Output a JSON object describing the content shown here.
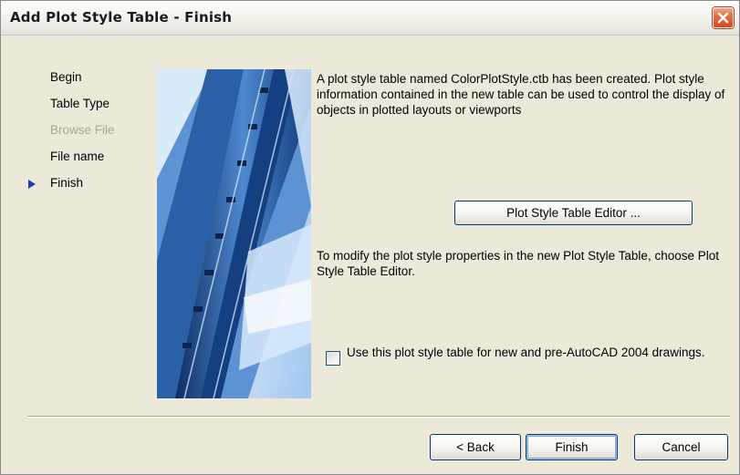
{
  "window": {
    "title": "Add Plot Style Table - Finish",
    "close_icon": "close-icon"
  },
  "nav": {
    "items": [
      {
        "label": "Begin",
        "state": "normal"
      },
      {
        "label": "Table Type",
        "state": "normal"
      },
      {
        "label": "Browse File",
        "state": "disabled"
      },
      {
        "label": "File name",
        "state": "normal"
      },
      {
        "label": "Finish",
        "state": "current"
      }
    ],
    "current_marker_icon": "triangle-right-icon"
  },
  "main": {
    "description": "A plot style table named ColorPlotStyle.ctb has been created. Plot style information contained in the new table can be used to control the display of objects in plotted layouts or viewports",
    "editor_button_label": "Plot Style Table Editor ...",
    "modify_text": "To modify the plot style properties in the new Plot Style Table, choose Plot Style Table Editor.",
    "checkbox": {
      "checked": false,
      "label": "Use this plot style table for new and pre-AutoCAD 2004 drawings."
    }
  },
  "footer": {
    "back_label": "< Back",
    "finish_label": "Finish",
    "cancel_label": "Cancel"
  },
  "colors": {
    "dialog_bg": "#ece9d8",
    "button_border": "#003c74",
    "nav_marker": "#1f3fa8",
    "disabled_text": "#a7a6a0",
    "close_button": "#e46a44"
  }
}
